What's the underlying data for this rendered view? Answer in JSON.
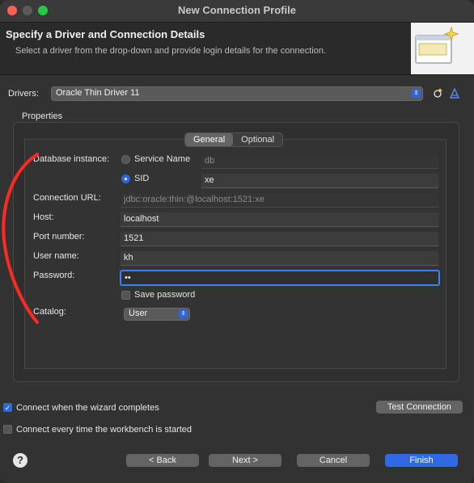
{
  "window": {
    "title": "New Connection Profile"
  },
  "header": {
    "title": "Specify a Driver and Connection Details",
    "subtitle": "Select a driver from the drop-down and provide login details for the connection."
  },
  "drivers": {
    "label": "Drivers:",
    "selected": "Oracle Thin Driver 11"
  },
  "properties": {
    "label": "Properties",
    "tabs": [
      "General",
      "Optional"
    ],
    "selected_tab": "General",
    "database_instance_label": "Database instance:",
    "service_name_label": "Service Name",
    "service_name_value": "db",
    "sid_label": "SID",
    "sid_value": "xe",
    "connection_url_label": "Connection URL:",
    "connection_url_value": "jdbc:oracle:thin:@localhost:1521:xe",
    "host_label": "Host:",
    "host_value": "localhost",
    "port_label": "Port number:",
    "port_value": "1521",
    "user_label": "User name:",
    "user_value": "kh",
    "password_label": "Password:",
    "password_value": "••",
    "save_password_label": "Save password",
    "catalog_label": "Catalog:",
    "catalog_value": "User"
  },
  "options": {
    "connect_when_completes": "Connect when the wizard completes",
    "connect_every_time": "Connect every time the workbench is started",
    "test_connection": "Test Connection"
  },
  "footer": {
    "help": "?",
    "back": "< Back",
    "next": "Next >",
    "cancel": "Cancel",
    "finish": "Finish"
  }
}
